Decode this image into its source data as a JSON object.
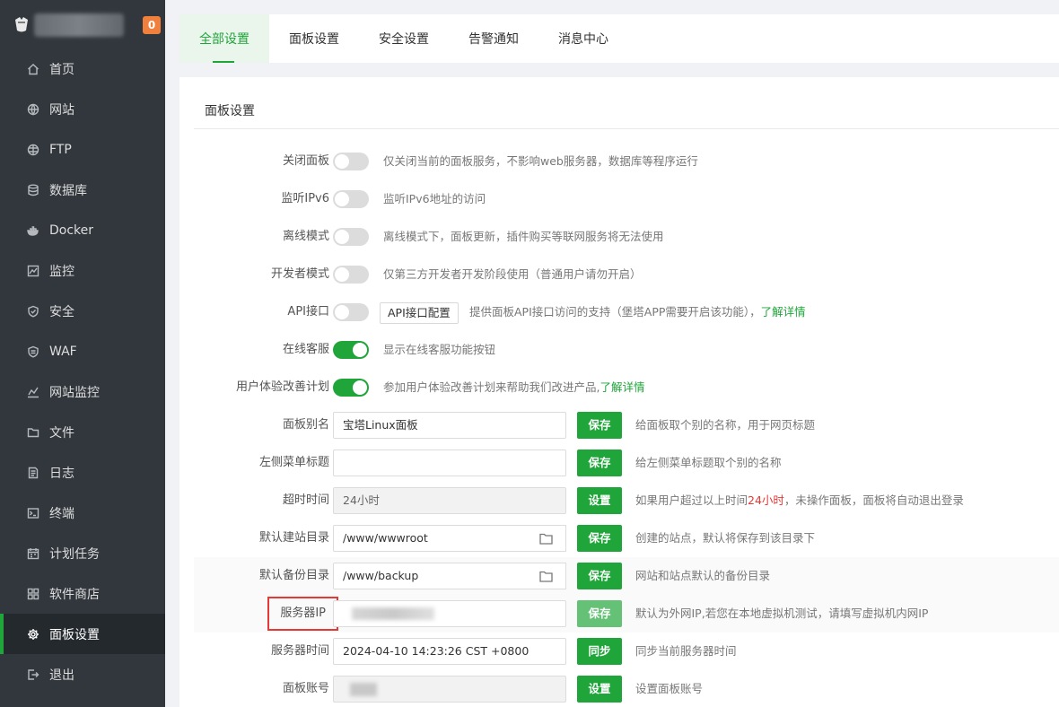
{
  "sidebar": {
    "badge": "0",
    "items": [
      {
        "label": "首页",
        "icon": "home-icon"
      },
      {
        "label": "网站",
        "icon": "globe-icon"
      },
      {
        "label": "FTP",
        "icon": "ftp-globe-icon"
      },
      {
        "label": "数据库",
        "icon": "database-icon"
      },
      {
        "label": "Docker",
        "icon": "docker-icon"
      },
      {
        "label": "监控",
        "icon": "monitor-chart-icon"
      },
      {
        "label": "安全",
        "icon": "shield-icon"
      },
      {
        "label": "WAF",
        "icon": "waf-shield-icon"
      },
      {
        "label": "网站监控",
        "icon": "site-monitor-icon"
      },
      {
        "label": "文件",
        "icon": "folder-icon"
      },
      {
        "label": "日志",
        "icon": "log-icon"
      },
      {
        "label": "终端",
        "icon": "terminal-icon"
      },
      {
        "label": "计划任务",
        "icon": "calendar-icon"
      },
      {
        "label": "软件商店",
        "icon": "apps-grid-icon"
      },
      {
        "label": "面板设置",
        "icon": "gear-icon",
        "active": true
      },
      {
        "label": "退出",
        "icon": "logout-icon"
      }
    ]
  },
  "tabs": [
    {
      "label": "全部设置",
      "active": true
    },
    {
      "label": "面板设置"
    },
    {
      "label": "安全设置"
    },
    {
      "label": "告警通知"
    },
    {
      "label": "消息中心"
    }
  ],
  "panel": {
    "title": "面板设置",
    "rows": {
      "close_panel": {
        "label": "关闭面板",
        "on": false,
        "desc": "仅关闭当前的面板服务，不影响web服务器，数据库等程序运行"
      },
      "ipv6": {
        "label": "监听IPv6",
        "on": false,
        "desc": "监听IPv6地址的访问"
      },
      "offline": {
        "label": "离线模式",
        "on": false,
        "desc": "离线模式下，面板更新，插件购买等联网服务将无法使用"
      },
      "developer": {
        "label": "开发者模式",
        "on": false,
        "desc": "仅第三方开发者开发阶段使用（普通用户请勿开启）"
      },
      "api": {
        "label": "API接口",
        "on": false,
        "button": "API接口配置",
        "desc": "提供面板API接口访问的支持（堡塔APP需要开启该功能），",
        "link": "了解详情"
      },
      "online_service": {
        "label": "在线客服",
        "on": true,
        "desc": "显示在线客服功能按钮"
      },
      "ux_plan": {
        "label": "用户体验改善计划",
        "on": true,
        "desc": "参加用户体验改善计划来帮助我们改进产品,",
        "link": "了解详情"
      },
      "alias": {
        "label": "面板别名",
        "value": "宝塔Linux面板",
        "button": "保存",
        "desc": "给面板取个别的名称，用于网页标题"
      },
      "menu_title": {
        "label": "左侧菜单标题",
        "value": "",
        "button": "保存",
        "desc": "给左侧菜单标题取个别的名称"
      },
      "timeout": {
        "label": "超时时间",
        "value": "24小时",
        "button": "设置",
        "desc_pre": "如果用户超过以上时间",
        "desc_red": "24小时",
        "desc_post": "，未操作面板，面板将自动退出登录"
      },
      "site_dir": {
        "label": "默认建站目录",
        "value": "/www/wwwroot",
        "button": "保存",
        "desc": "创建的站点，默认将保存到该目录下"
      },
      "backup_dir": {
        "label": "默认备份目录",
        "value": "/www/backup",
        "button": "保存",
        "desc": "网站和站点默认的备份目录"
      },
      "server_ip": {
        "label": "服务器IP",
        "button": "保存",
        "desc": "默认为外网IP,若您在本地虚拟机测试，请填写虚拟机内网IP"
      },
      "server_time": {
        "label": "服务器时间",
        "value": "2024-04-10 14:23:26 CST +0800",
        "button": "同步",
        "desc": "同步当前服务器时间"
      },
      "account": {
        "label": "面板账号",
        "button": "设置",
        "desc": "设置面板账号"
      }
    }
  }
}
